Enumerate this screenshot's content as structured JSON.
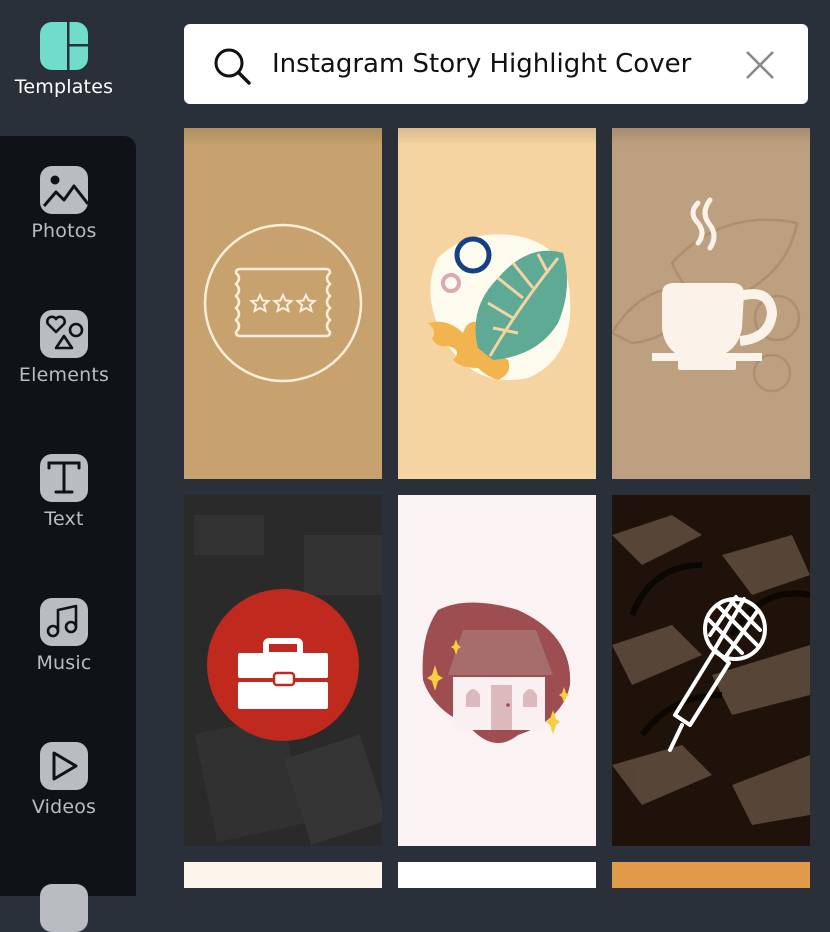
{
  "sidebar": {
    "items": [
      {
        "id": "templates",
        "label": "Templates",
        "icon": "templates-icon",
        "active": true
      },
      {
        "id": "photos",
        "label": "Photos",
        "icon": "photos-icon",
        "active": false
      },
      {
        "id": "elements",
        "label": "Elements",
        "icon": "elements-icon",
        "active": false
      },
      {
        "id": "text",
        "label": "Text",
        "icon": "text-icon",
        "active": false
      },
      {
        "id": "music",
        "label": "Music",
        "icon": "music-icon",
        "active": false
      },
      {
        "id": "videos",
        "label": "Videos",
        "icon": "videos-icon",
        "active": false
      }
    ]
  },
  "search": {
    "value": "Instagram Story Highlight Cover",
    "search_icon": "search-icon",
    "clear_icon": "close-icon"
  },
  "templates": [
    {
      "name": "ticket-cover",
      "background": "#c8a26e",
      "motif": "ticket-icon"
    },
    {
      "name": "monstera-leaf-cover",
      "background": "#f6d4a2",
      "motif": "leaf-icon"
    },
    {
      "name": "coffee-cup-cover",
      "background": "#bda080",
      "motif": "coffee-cup-icon"
    },
    {
      "name": "briefcase-cover",
      "background": "#2a2a2a",
      "accent": "#c0291e",
      "motif": "briefcase-icon"
    },
    {
      "name": "house-cover",
      "background": "#fbf2f3",
      "accent": "#9e4d50",
      "motif": "house-icon"
    },
    {
      "name": "microphone-cover",
      "background": "#1e120a",
      "motif": "microphone-icon"
    },
    {
      "name": "partial-cover-1",
      "background": "#fdf5ec"
    },
    {
      "name": "partial-cover-2",
      "background": "#ffffff"
    },
    {
      "name": "partial-cover-3",
      "background": "#e09a4a"
    }
  ],
  "colors": {
    "app_bg": "#293039",
    "sidebar_panel": "#0f1318",
    "templates_accent": "#6fdccc",
    "icon_gray": "#b9bcc0"
  }
}
